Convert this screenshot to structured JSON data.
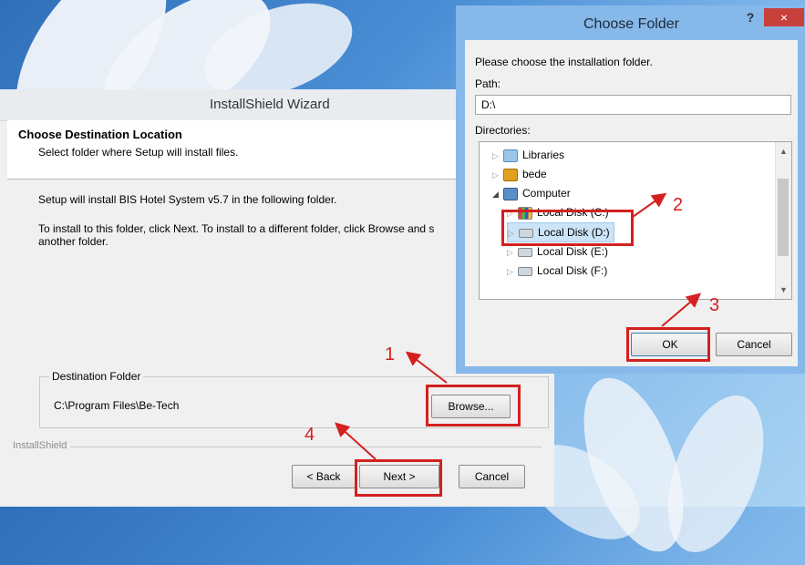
{
  "wizard": {
    "title": "InstallShield Wizard",
    "heading": "Choose Destination Location",
    "subheading": "Select folder where Setup will install files.",
    "body_line1": "Setup will install BIS Hotel System v5.7 in the following folder.",
    "body_line2": "To install to this folder, click Next. To install to a different folder, click Browse and s another folder.",
    "destination_label": "Destination Folder",
    "destination_path": "C:\\Program Files\\Be-Tech",
    "browse_label": "Browse...",
    "installshield_label": "InstallShield",
    "back_label": "< Back",
    "next_label": "Next >",
    "cancel_label": "Cancel"
  },
  "dialog": {
    "title": "Choose Folder",
    "help_glyph": "?",
    "close_glyph": "×",
    "instruction": "Please choose the installation folder.",
    "path_label": "Path:",
    "path_value": "D:\\",
    "directories_label": "Directories:",
    "tree": [
      {
        "label": "Libraries",
        "icon": "libraries-icon"
      },
      {
        "label": "bede",
        "icon": "user-folder-icon"
      },
      {
        "label": "Computer",
        "icon": "computer-icon"
      },
      {
        "label": "Local Disk (C:)",
        "icon": "system-drive-icon"
      },
      {
        "label": "Local Disk (D:)",
        "icon": "drive-icon",
        "selected": true
      },
      {
        "label": "Local Disk (E:)",
        "icon": "drive-icon"
      },
      {
        "label": "Local Disk (F:)",
        "icon": "drive-icon"
      }
    ],
    "ok_label": "OK",
    "cancel_label": "Cancel"
  },
  "annotations": {
    "step1": "1",
    "step2": "2",
    "step3": "3",
    "step4": "4",
    "color": "#d42020"
  }
}
